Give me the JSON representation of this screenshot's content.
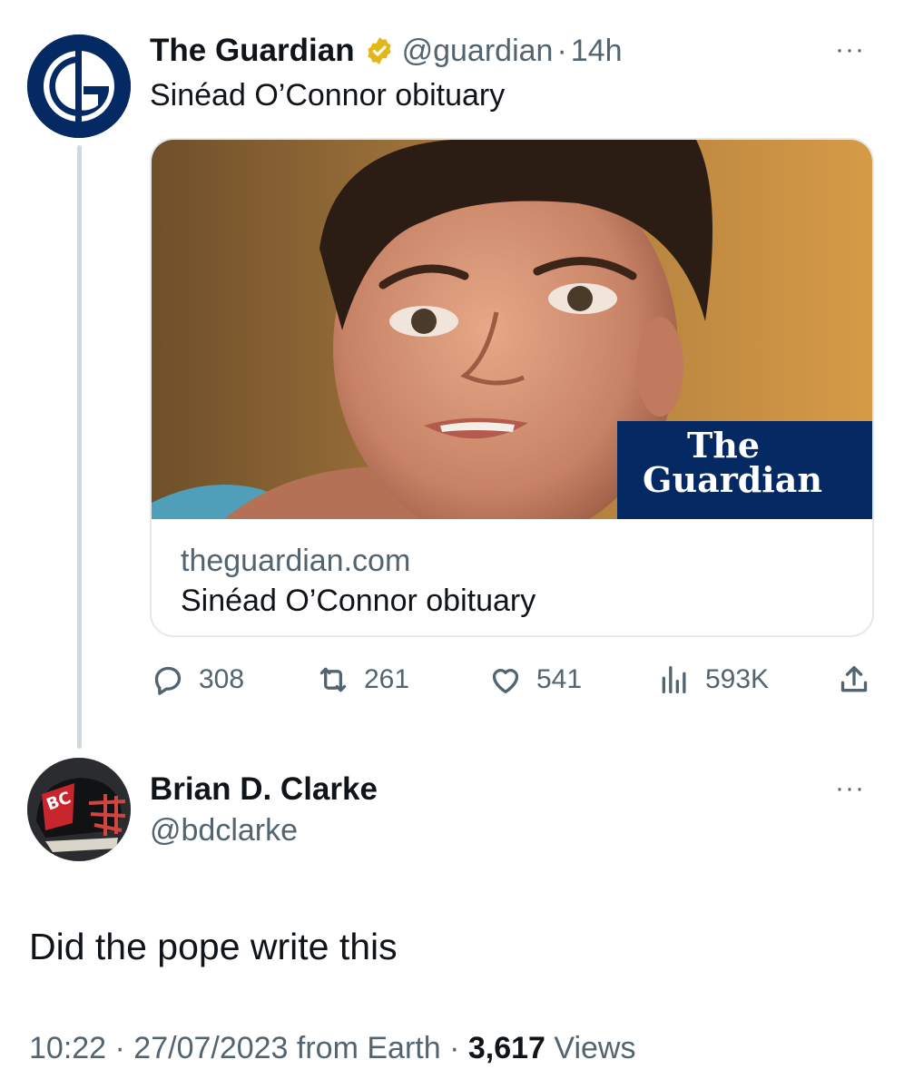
{
  "guardian_tweet": {
    "name": "The Guardian",
    "handle": "@guardian",
    "separator": "·",
    "time": "14h",
    "more": "···",
    "text": "Sinéad O’Connor obituary",
    "card": {
      "domain": "theguardian.com",
      "title": "Sinéad O’Connor obituary",
      "logo_line1": "The",
      "logo_line2": "Guardian"
    },
    "actions": {
      "replies": "308",
      "retweets": "261",
      "likes": "541",
      "views": "593K"
    }
  },
  "reply_tweet": {
    "name": "Brian D. Clarke",
    "handle": "@bdclarke",
    "more": "···",
    "text": "Did the pope write this",
    "timestamp": "10:22 · 27/07/2023 from Earth · ",
    "views_count": "3,617",
    "views_label": " Views"
  },
  "colors": {
    "guardian_blue": "#052962",
    "verified_gold": "#e2b719",
    "secondary_text": "#536471",
    "primary_text": "#0f1419"
  },
  "icons": [
    "verified-badge-icon",
    "more-icon",
    "reply-icon",
    "retweet-icon",
    "like-icon",
    "views-icon",
    "share-icon"
  ]
}
